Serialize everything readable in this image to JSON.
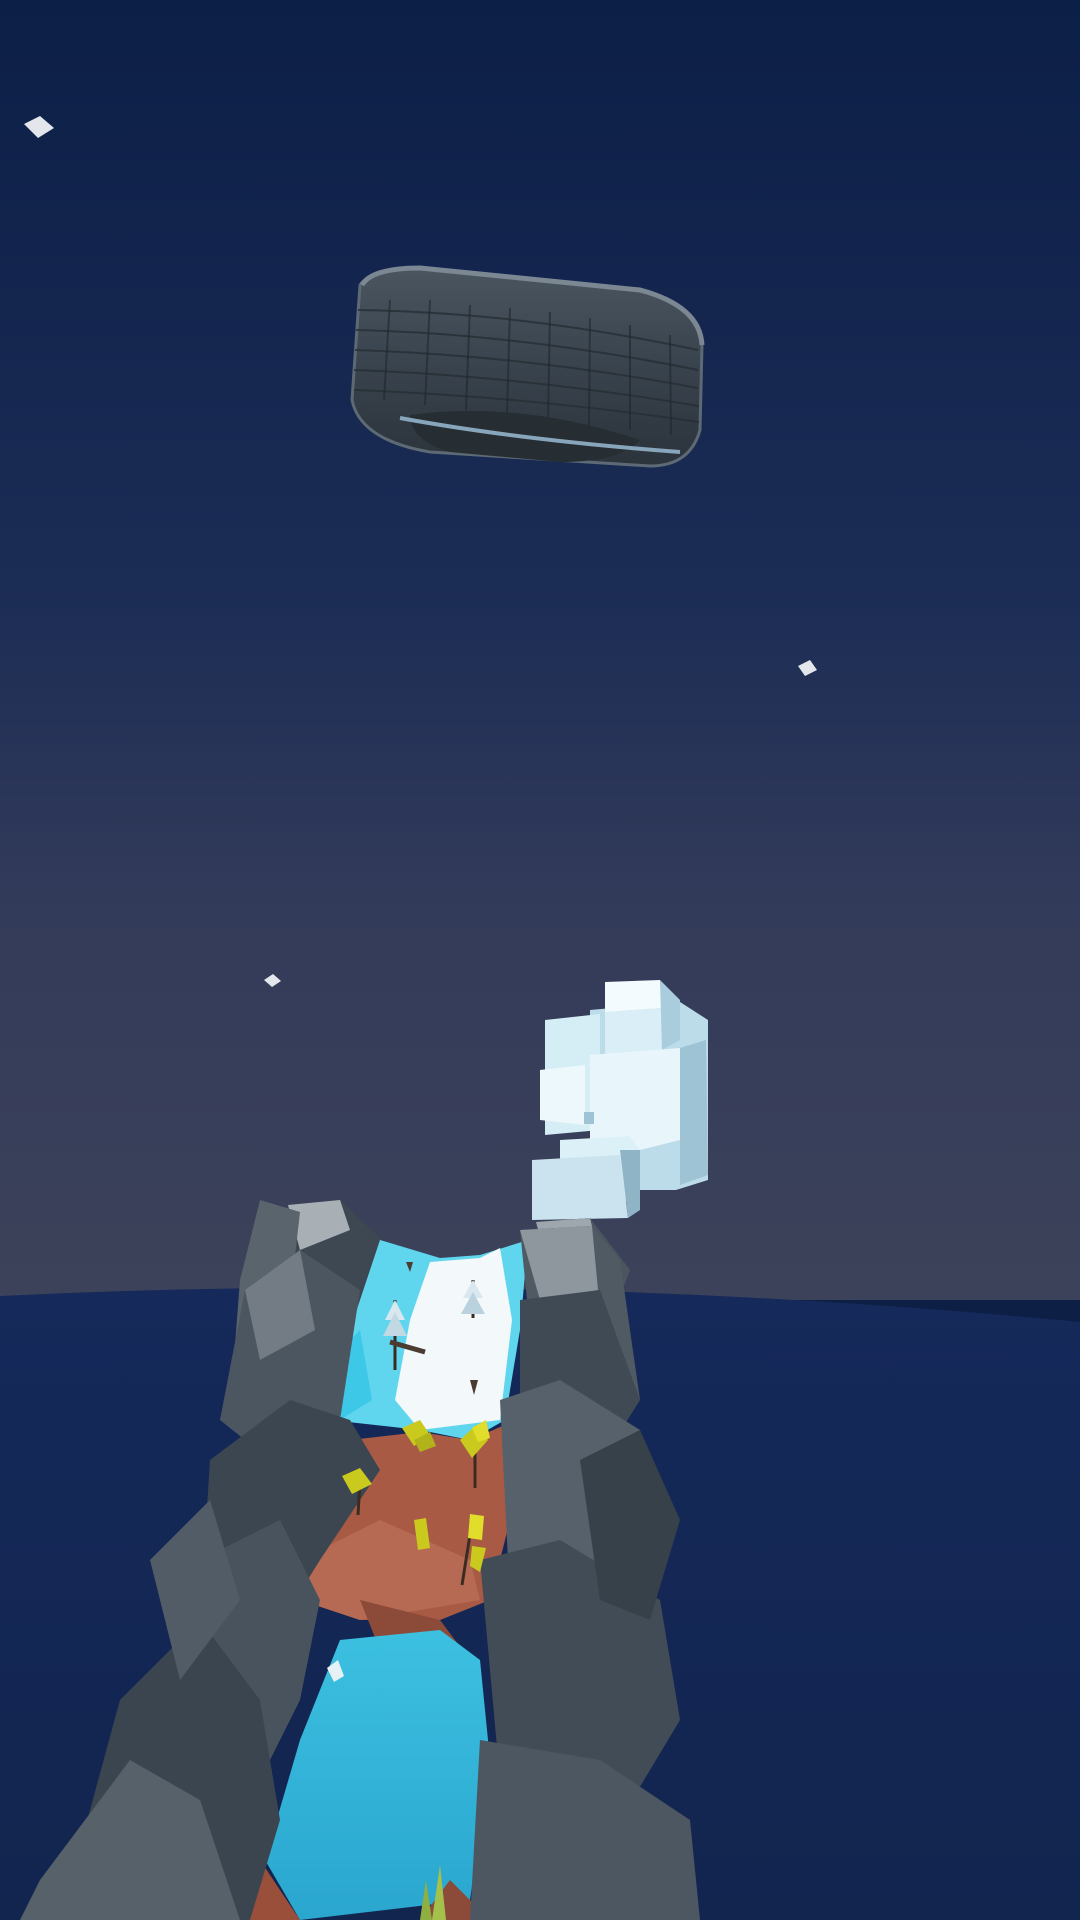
{
  "scene": {
    "type": "low-poly-3d-game-view",
    "sky_top_color": "#0c1f47",
    "sky_horizon_color": "#3a4058",
    "sea_color": "#14295a",
    "objects": [
      {
        "name": "tire",
        "color": "#3f4a55"
      },
      {
        "name": "ice-cube-cluster",
        "color": "#e6f6fb"
      },
      {
        "name": "mountain-canyon",
        "color": "#3b4650"
      },
      {
        "name": "snow-path",
        "color": "#f3f8fb"
      },
      {
        "name": "ice-river",
        "color": "#5fd6ee"
      },
      {
        "name": "dirt-slope",
        "color": "#a95a45"
      },
      {
        "name": "water-pool",
        "color": "#2fb2d8"
      },
      {
        "name": "yellow-bush",
        "color": "#c9c91e"
      },
      {
        "name": "snow-particle",
        "color": "#e6e9ee"
      }
    ]
  }
}
